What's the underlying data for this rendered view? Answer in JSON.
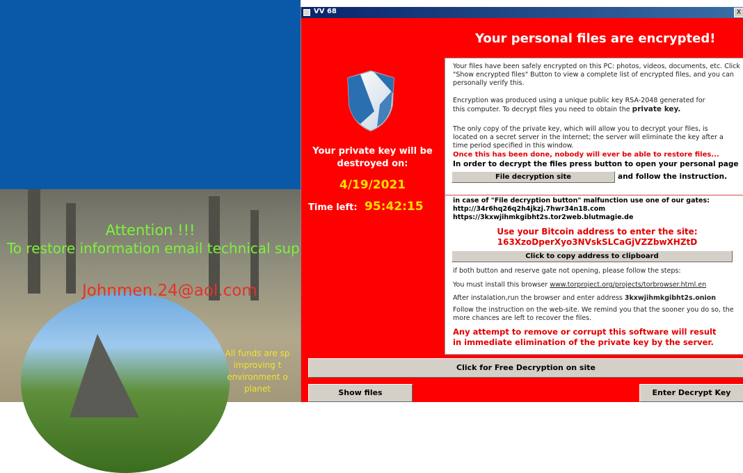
{
  "desktop": {
    "attention_line1": "Attention !!!",
    "attention_line2": "To restore information email technical sup",
    "email": "Johnmen.24@aol.com",
    "note_lines": [
      "All funds are sp",
      "improving t",
      "environment o",
      "planet"
    ]
  },
  "window": {
    "title": "VV 68",
    "close_label": "X",
    "headline": "Your personal files are encrypted!",
    "private_key_text": "Your private key will be destroyed on:",
    "destroy_date": "4/19/2021",
    "time_left_label": "Time left:",
    "time_left_value": "95:42:15",
    "panel": {
      "para1": "Your files have been safely encrypted on this PC: photos, videos, documents, etc. Click \"Show encrypted files\" Button to view a complete list of encrypted files, and you can personally verify this.",
      "para2_a": "Encryption was produced using a unique public key RSA-2048 generated for this computer. To decrypt files you need to obtain the ",
      "para2_b": "private key.",
      "para3": "The only copy of the private key, which will allow you to decrypt your files, is located on a secret server in the Internet; the server will eliminate the key after a time period specified in this window.",
      "warning1": "Once this has been done, nobody will ever be able to restore files...",
      "instruction": "In order to decrypt the files press button to open your personal page",
      "decrypt_site_btn": "File decryption site",
      "follow_text": "and follow the instruction.",
      "gates_text": "in case of \"File decryption button\" malfunction use one of our gates:",
      "gate1": "http://34r6hq26q2h4jkzj.7hwr34n18.com",
      "gate2": "https://3kxwjihmkgibht2s.tor2web.blutmagie.de",
      "bitcoin_line": "Use your Bitcoin address to  enter the site:",
      "bitcoin_address": "163XzoDperXyo3NVskSLCaGjVZZbwXHZtD",
      "copy_btn": "Click to copy address to clipboard",
      "steps_intro": "if both button and reserve gate not opening, please follow the steps:",
      "install_text": "You must install this browser ",
      "install_link": "www.torproject.org/projects/torbrowser.html.en",
      "after_text": "After instalation,run the browser and enter address ",
      "onion_address": "3kxwjihmkgibht2s.onion",
      "follow_site": "Follow the instruction on the web-site. We remind you that the sooner you do so, the more chances are left to recover the files.",
      "warning2_line1": "Any attempt to remove or corrupt this software will result",
      "warning2_line2": "in immediate elimination of the private key by the server."
    },
    "free_decrypt_btn": "Click for Free Decryption on site",
    "show_files_btn": "Show files",
    "enter_key_btn": "Enter Decrypt Key"
  },
  "colors": {
    "window_bg": "#ff0000",
    "desktop_blue": "#0a58a8",
    "accent_yellow": "#ffe100",
    "attention_green": "#7df23a",
    "email_red": "#e4322a"
  }
}
